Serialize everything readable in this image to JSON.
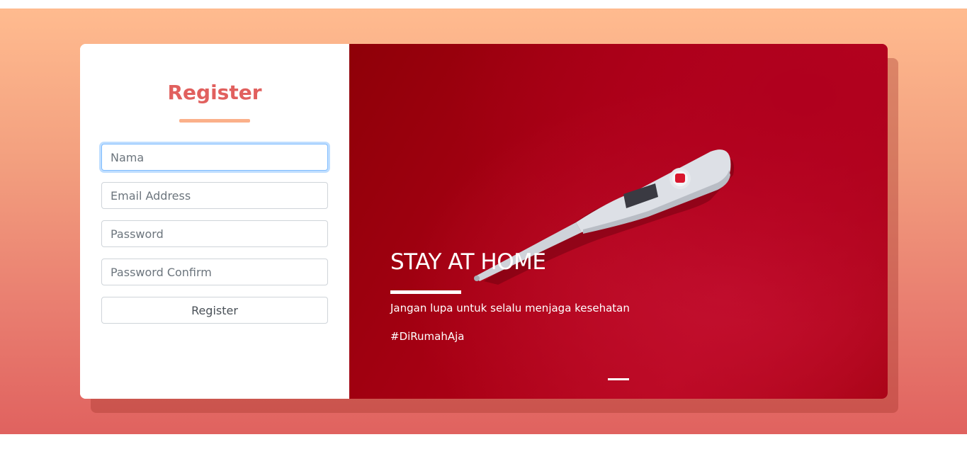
{
  "form": {
    "title": "Register",
    "fields": [
      {
        "placeholder": "Nama",
        "value": ""
      },
      {
        "placeholder": "Email Address",
        "value": ""
      },
      {
        "placeholder": "Password",
        "value": ""
      },
      {
        "placeholder": "Password Confirm",
        "value": ""
      }
    ],
    "submit_label": "Register"
  },
  "hero": {
    "title": "STAY AT HOME",
    "text": "Jangan lupa untuk selalu menjaga kesehatan",
    "hashtag": "#DiRumahAja",
    "image": "thermometer"
  },
  "colors": {
    "accent": "#e1605e",
    "underline": "#fbb08a",
    "hero_red": "#a80014"
  }
}
